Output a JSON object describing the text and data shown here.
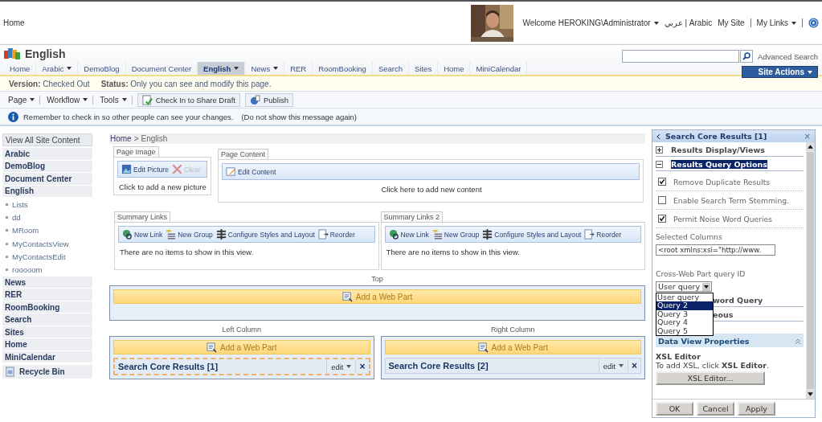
{
  "top_bar": {
    "home": "Home",
    "welcome": {
      "label": "Welcome HEROKING\\Administrator",
      "menu": true
    },
    "language": "عربي | Arabic",
    "my_site": "My Site",
    "my_links": {
      "label": "My Links",
      "menu": true
    }
  },
  "site": {
    "title": "English",
    "advanced_search": "Advanced Search",
    "site_actions": {
      "label": "Site Actions",
      "menu": true
    }
  },
  "tabs": [
    {
      "label": "Home",
      "menu": false,
      "selected": false
    },
    {
      "label": "Arabic",
      "menu": true,
      "selected": false
    },
    {
      "label": "DemoBlog",
      "menu": false,
      "selected": false
    },
    {
      "label": "Document Center",
      "menu": false,
      "selected": false
    },
    {
      "label": "English",
      "menu": true,
      "selected": true
    },
    {
      "label": "News",
      "menu": true,
      "selected": false
    },
    {
      "label": "RER",
      "menu": false,
      "selected": false
    },
    {
      "label": "RoomBooking",
      "menu": false,
      "selected": false
    },
    {
      "label": "Search",
      "menu": false,
      "selected": false
    },
    {
      "label": "Sites",
      "menu": false,
      "selected": false
    },
    {
      "label": "Home",
      "menu": false,
      "selected": false
    },
    {
      "label": "MiniCalendar",
      "menu": false,
      "selected": false
    }
  ],
  "status_bar": {
    "version_label": "Version:",
    "version": "Checked Out",
    "status_label": "Status:",
    "status": "Only you can see and modify this page."
  },
  "toolbar": {
    "menus": [
      {
        "label": "Page",
        "menu": true
      },
      {
        "label": "Workflow",
        "menu": true
      },
      {
        "label": "Tools",
        "menu": true
      }
    ],
    "buttons": [
      "Check In to Share Draft",
      "Publish"
    ]
  },
  "message": {
    "text": "Remember to check in so other people can see your changes.",
    "link": "(Do not show this message again)"
  },
  "sidebar": [
    {
      "kind": "view_all",
      "label": "View All Site Content"
    },
    {
      "kind": "heading",
      "label": "Arabic"
    },
    {
      "kind": "heading",
      "label": "DemoBlog"
    },
    {
      "kind": "heading",
      "label": "Document Center"
    },
    {
      "kind": "heading",
      "label": "English"
    },
    {
      "kind": "sub",
      "label": "Lists"
    },
    {
      "kind": "sub",
      "label": "dd"
    },
    {
      "kind": "sub",
      "label": "MRoom"
    },
    {
      "kind": "sub",
      "label": "MyContactsView"
    },
    {
      "kind": "sub",
      "label": "MyContactsEdit"
    },
    {
      "kind": "sub",
      "label": "rooooom"
    },
    {
      "kind": "heading",
      "label": "News"
    },
    {
      "kind": "heading",
      "label": "RER"
    },
    {
      "kind": "heading",
      "label": "RoomBooking"
    },
    {
      "kind": "heading",
      "label": "Search"
    },
    {
      "kind": "heading",
      "label": "Sites"
    },
    {
      "kind": "heading",
      "label": "Home"
    },
    {
      "kind": "heading",
      "label": "MiniCalendar"
    },
    {
      "kind": "recycle",
      "label": "Recycle Bin"
    }
  ],
  "breadcrumb": {
    "items": [
      "Home",
      "English"
    ],
    "separator": ">"
  },
  "page_image": {
    "title": "Page Image",
    "edit": "Edit Picture",
    "clear": {
      "label": "Clear",
      "disabled": true
    },
    "hint": "Click to add a new picture"
  },
  "page_content": {
    "title": "Page Content",
    "edit": "Edit Content",
    "hint": "Click here to add new content"
  },
  "summary_links": [
    {
      "title": "Summary Links",
      "tools": [
        "New Link",
        "New Group",
        "Configure Styles and Layout",
        "Reorder"
      ],
      "empty": "There are no items to show in this view."
    },
    {
      "title": "Summary Links 2",
      "tools": [
        "New Link",
        "New Group",
        "Configure Styles and Layout",
        "Reorder"
      ],
      "empty": "There are no items to show in this view."
    }
  ],
  "top_zone": {
    "label": "Top",
    "add": "Add a Web Part"
  },
  "columns": [
    {
      "label": "Left Column",
      "add": "Add a Web Part",
      "web_part": {
        "title": "Search Core Results [1]",
        "edit": "edit",
        "close": "×",
        "selected": true
      }
    },
    {
      "label": "Right Column",
      "add": "Add a Web Part",
      "web_part": {
        "title": "Search Core Results [2]",
        "edit": "edit",
        "close": "×",
        "selected": false
      }
    }
  ],
  "tool_pane": {
    "title": "Search Core Results [1]",
    "close": "×",
    "items": [
      {
        "kind": "section",
        "label": "Results Display/Views",
        "expanded": false,
        "selected": false
      },
      {
        "kind": "section",
        "label": "Results Query Options",
        "expanded": true,
        "selected": true
      },
      {
        "kind": "checkbox",
        "label": "Remove Duplicate Results",
        "checked": true
      },
      {
        "kind": "checkbox",
        "label": "Enable Search Term Stemming.",
        "checked": false
      },
      {
        "kind": "checkbox",
        "label": "Permit Noise Word Queries",
        "checked": true
      },
      {
        "kind": "label",
        "label": "Selected Columns"
      },
      {
        "kind": "textfield",
        "value": "<root xmlns:xsi=\"http://www."
      },
      {
        "kind": "label",
        "label": "Cross-Web Part query ID"
      },
      {
        "kind": "select",
        "value": "User query",
        "open": true,
        "options": [
          {
            "label": "User query",
            "highlighted": false
          },
          {
            "label": "Query 2",
            "highlighted": true
          },
          {
            "label": "Query 3",
            "highlighted": false
          },
          {
            "label": "Query 4",
            "highlighted": false
          },
          {
            "label": "Query 5",
            "highlighted": false
          }
        ]
      },
      {
        "kind": "covered",
        "label": "word Query"
      },
      {
        "kind": "covered",
        "label": "eous"
      },
      {
        "kind": "group",
        "label": "Data View Properties"
      },
      {
        "kind": "heading",
        "label": "XSL Editor"
      },
      {
        "kind": "text",
        "label": "To add XSL, click **XSL Editor**."
      },
      {
        "kind": "button",
        "label": "XSL Editor..."
      }
    ],
    "buttons": [
      "OK",
      "Cancel",
      "Apply"
    ]
  }
}
